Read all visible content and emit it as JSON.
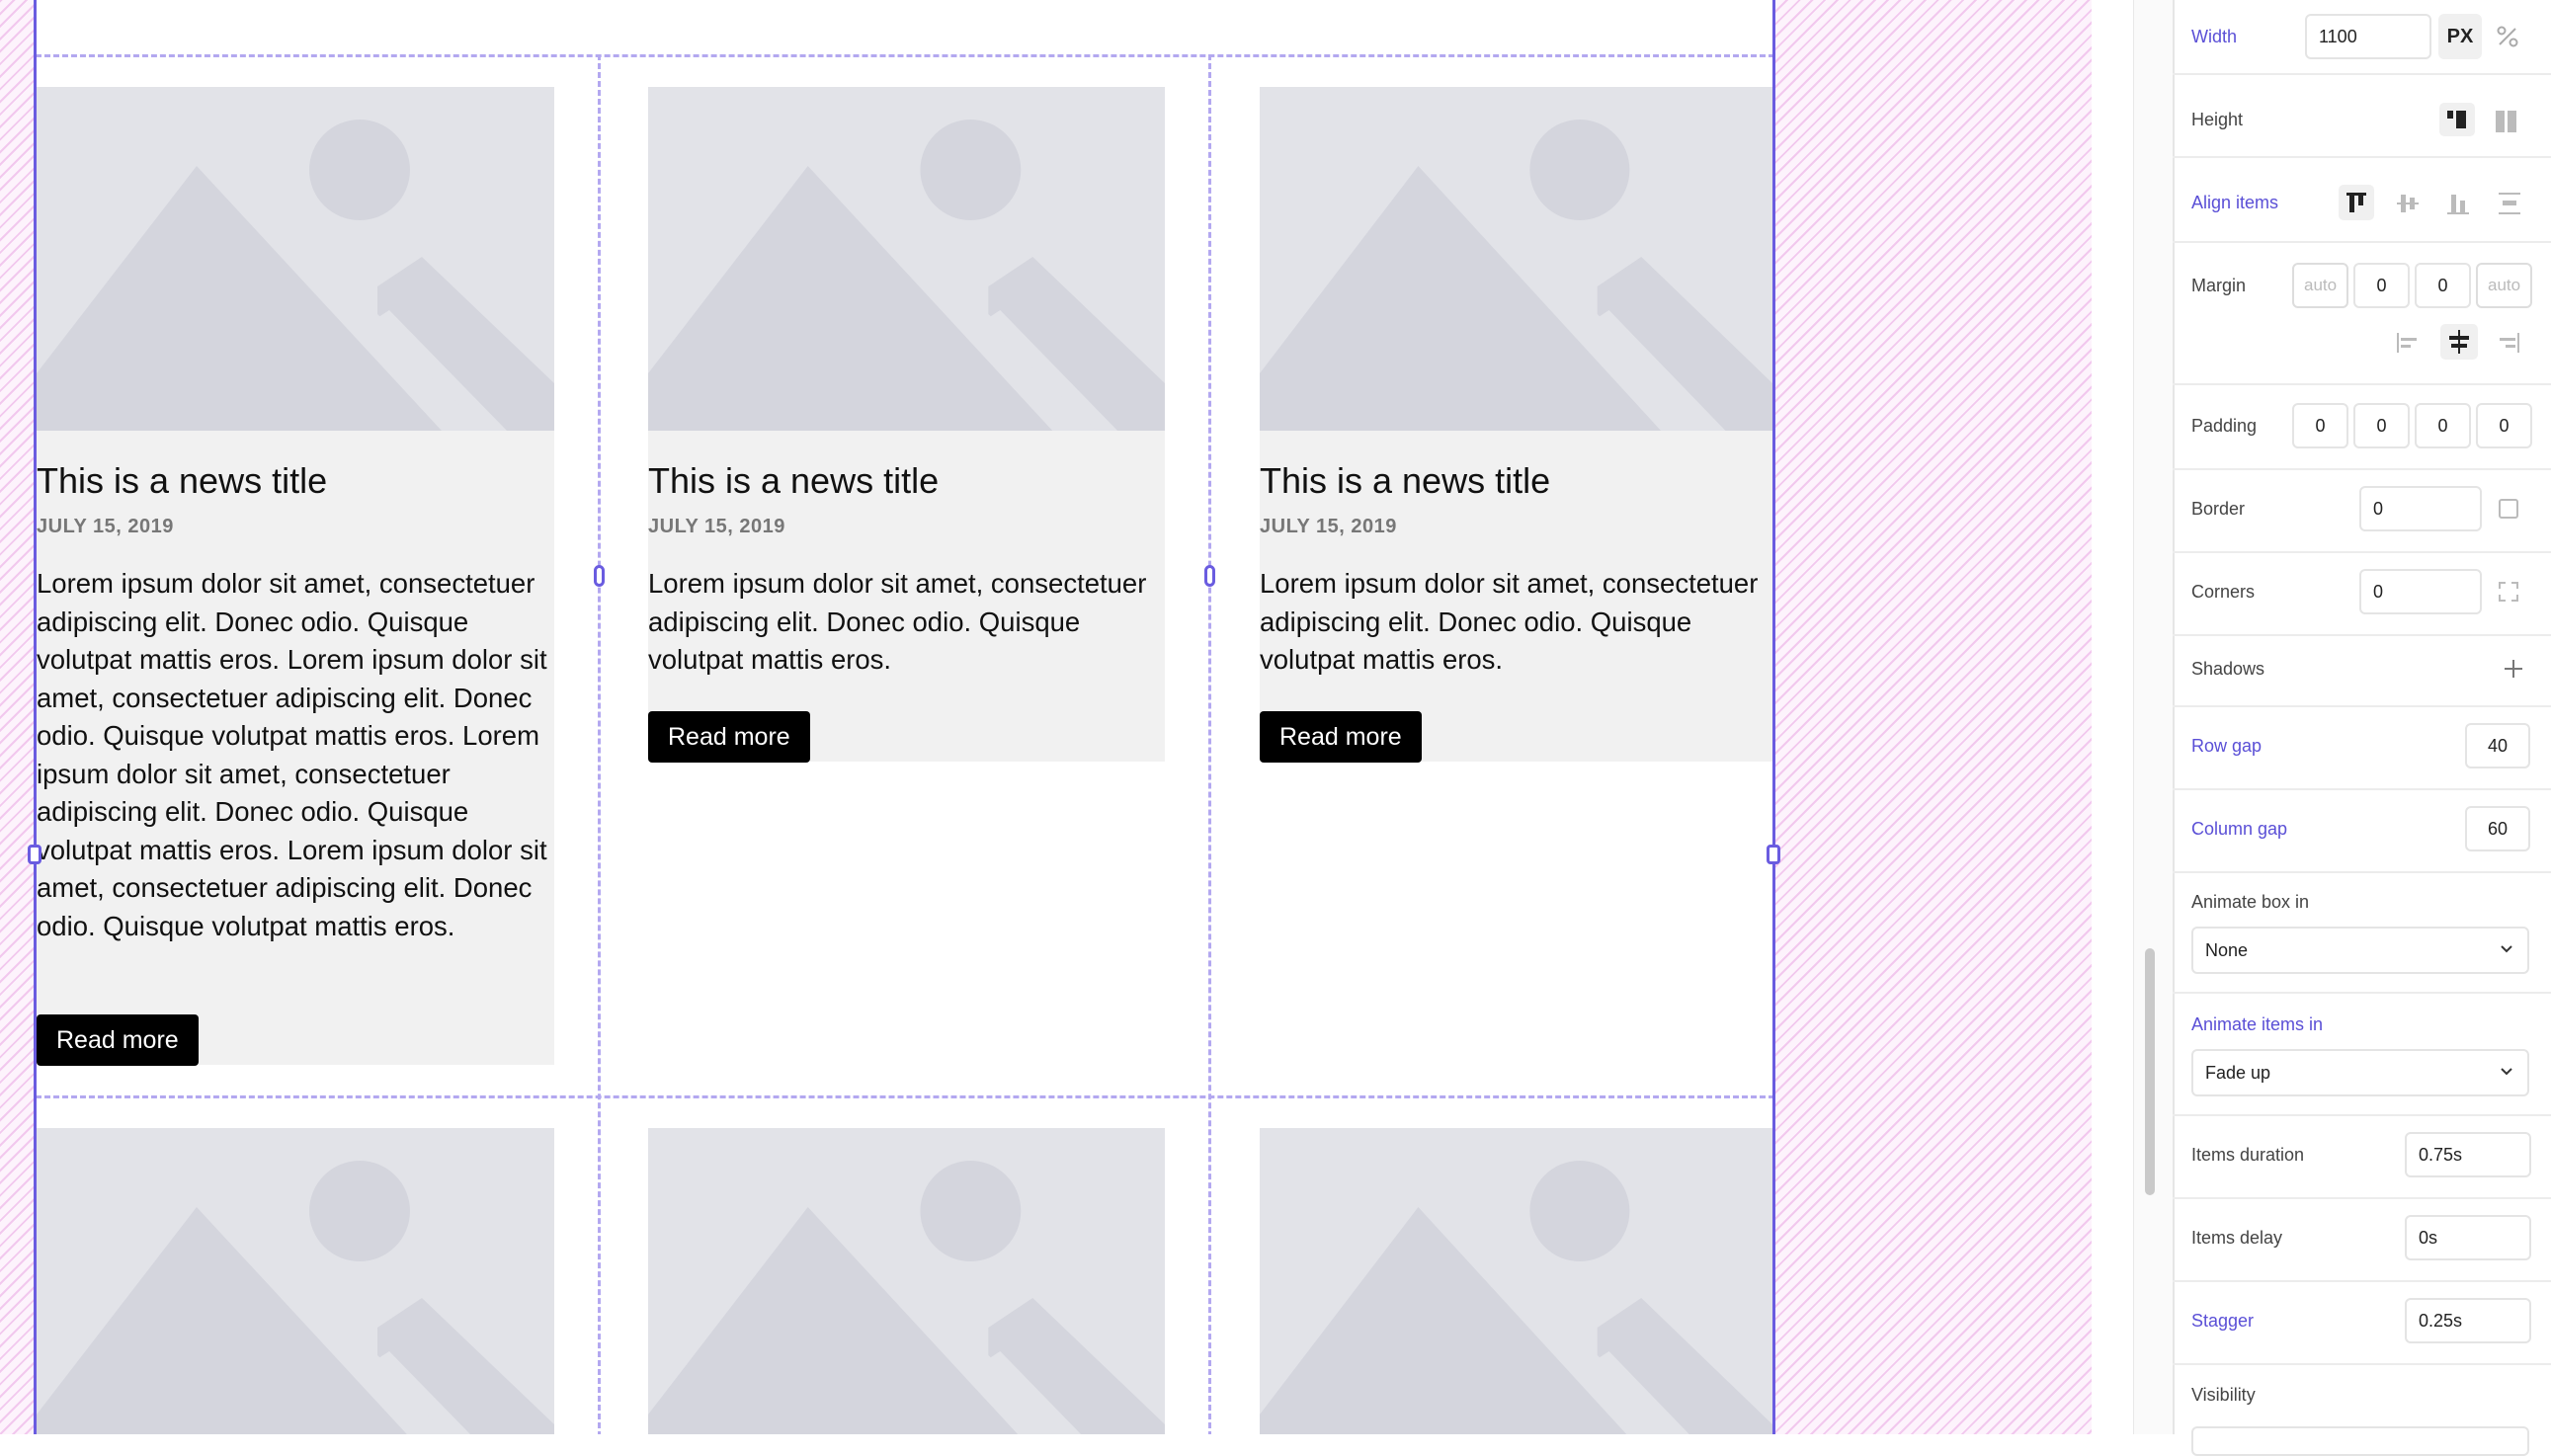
{
  "cards": [
    {
      "title": "This is a news title",
      "date": "JULY 15, 2019",
      "text": "Lorem ipsum dolor sit amet, consectetuer adipiscing elit. Donec odio. Quisque volutpat mattis eros. Lorem ipsum dolor sit amet, consectetuer adipiscing elit. Donec odio. Quisque volutpat mattis eros. Lorem ipsum dolor sit amet, consectetuer adipiscing elit. Donec odio. Quisque volutpat mattis eros. Lorem ipsum dolor sit amet, consectetuer adipiscing elit. Donec odio. Quisque volutpat mattis eros.",
      "button": "Read more"
    },
    {
      "title": "This is a news title",
      "date": "JULY 15, 2019",
      "text": "Lorem ipsum dolor sit amet, consectetuer adipiscing elit. Donec odio. Quisque volutpat mattis eros.",
      "button": "Read more"
    },
    {
      "title": "This is a news title",
      "date": "JULY 15, 2019",
      "text": "Lorem ipsum dolor sit amet, consectetuer adipiscing elit. Donec odio. Quisque volutpat mattis eros.",
      "button": "Read more"
    }
  ],
  "panel": {
    "width": {
      "label": "Width",
      "value": "1100",
      "unit_px": "PX"
    },
    "height": {
      "label": "Height"
    },
    "align_items": {
      "label": "Align items"
    },
    "margin": {
      "label": "Margin",
      "top": "auto",
      "right": "0",
      "bottom": "0",
      "left": "auto"
    },
    "padding": {
      "label": "Padding",
      "top": "0",
      "right": "0",
      "bottom": "0",
      "left": "0"
    },
    "border": {
      "label": "Border",
      "value": "0"
    },
    "corners": {
      "label": "Corners",
      "value": "0"
    },
    "shadows": {
      "label": "Shadows"
    },
    "row_gap": {
      "label": "Row gap",
      "value": "40"
    },
    "column_gap": {
      "label": "Column gap",
      "value": "60"
    },
    "animate_box_in": {
      "label": "Animate box in",
      "value": "None"
    },
    "animate_items_in": {
      "label": "Animate items in",
      "value": "Fade up"
    },
    "items_duration": {
      "label": "Items duration",
      "value": "0.75s"
    },
    "items_delay": {
      "label": "Items delay",
      "value": "0s"
    },
    "stagger": {
      "label": "Stagger",
      "value": "0.25s"
    },
    "visibility": {
      "label": "Visibility"
    }
  },
  "colors": {
    "accent": "#5a4fd6",
    "selection": "#6a5ce0",
    "guide": "#b3a8f0",
    "placeholder": "#e2e3e8"
  }
}
